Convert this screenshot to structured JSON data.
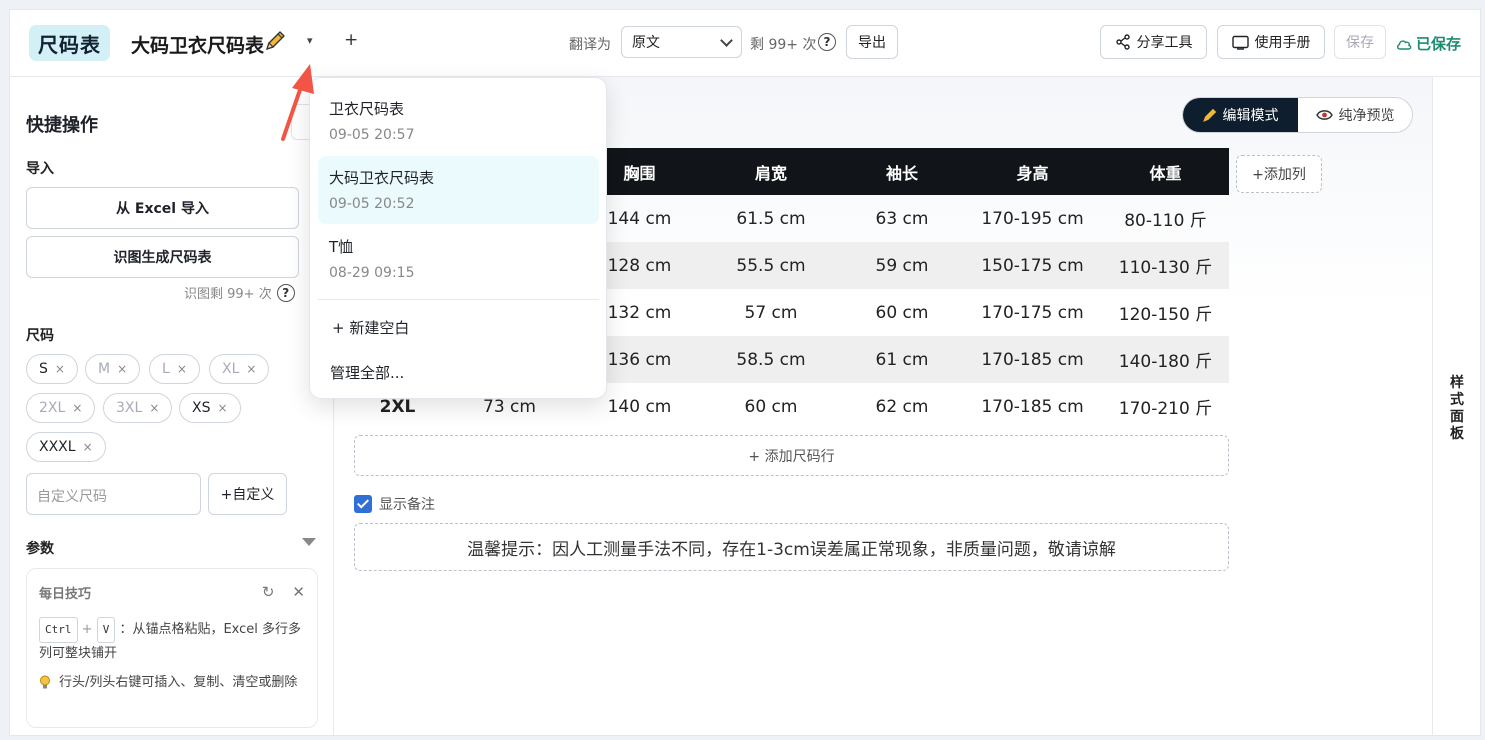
{
  "header": {
    "logo": "尺码表",
    "doc_title": "大码卫衣尺码表",
    "caret": "▾",
    "plus": "+",
    "translate_label": "翻译为",
    "translate_value": "原文",
    "remaining": "剩 99+ 次",
    "help": "?",
    "export_label": "导出",
    "share_label": "分享工具",
    "manual_label": "使用手册",
    "save_label": "保存",
    "saved_label": "已保存"
  },
  "sidebar": {
    "title": "快捷操作",
    "import_label": "导入",
    "excel_import": "从 Excel 导入",
    "ocr_generate": "识图生成尺码表",
    "ocr_remaining": "识图剩 99+ 次",
    "help": "?",
    "sizes_label": "尺码",
    "sizes": [
      {
        "label": "S",
        "x": "×"
      },
      {
        "label": "M",
        "x": "×"
      },
      {
        "label": "L",
        "x": "×"
      },
      {
        "label": "XL",
        "x": "×"
      },
      {
        "label": "2XL",
        "x": "×"
      },
      {
        "label": "3XL",
        "x": "×"
      },
      {
        "label": "XS",
        "x": "×"
      },
      {
        "label": "XXXL",
        "x": "×"
      }
    ],
    "custom_placeholder": "自定义尺码",
    "custom_button": "+自定义",
    "params_label": "参数",
    "tips": {
      "title": "每日技巧",
      "refresh_icon": "↻",
      "close_icon": "✕",
      "key1": "Ctrl",
      "plus": "+",
      "key2": "V",
      "tip1_text": "：从锚点格粘贴，Excel 多行多列可整块铺开",
      "tip2_text": "行头/列头右键可插入、复制、清空或删除"
    }
  },
  "main": {
    "mode_edit": "编辑模式",
    "mode_preview": "纯净预览",
    "columns": [
      "",
      "",
      "胸围",
      "肩宽",
      "袖长",
      "身高",
      "体重"
    ],
    "rows": [
      [
        "",
        "",
        "144 cm",
        "61.5 cm",
        "63 cm",
        "170-195 cm",
        "80-110 斤"
      ],
      [
        "",
        "",
        "128 cm",
        "55.5 cm",
        "59 cm",
        "150-175 cm",
        "110-130 斤"
      ],
      [
        "",
        "",
        "132 cm",
        "57 cm",
        "60 cm",
        "170-175 cm",
        "120-150 斤"
      ],
      [
        "",
        "",
        "136 cm",
        "58.5 cm",
        "61 cm",
        "170-185 cm",
        "140-180 斤"
      ],
      [
        "2XL",
        "73 cm",
        "140 cm",
        "60 cm",
        "62 cm",
        "170-185 cm",
        "170-210 斤"
      ]
    ],
    "add_col": "+添加列",
    "add_row": "+ 添加尺码行",
    "show_notes": "显示备注",
    "notes": "温馨提示：因人工测量手法不同，存在1-3cm误差属正常现象，非质量问题，敬请谅解"
  },
  "style_panel": {
    "label": "样式面板"
  },
  "dropdown": {
    "items": [
      {
        "name": "卫衣尺码表",
        "time": "09-05 20:57"
      },
      {
        "name": "大码卫衣尺码表",
        "time": "09-05 20:52"
      },
      {
        "name": "T恤",
        "time": "08-29 09:15"
      }
    ],
    "new_blank": "+  新建空白",
    "manage_all": "管理全部..."
  },
  "colors": {
    "accent": "#1d8c73",
    "logo_bg": "#d4f0f7",
    "dark": "#111418",
    "arrow": "#f25445"
  }
}
